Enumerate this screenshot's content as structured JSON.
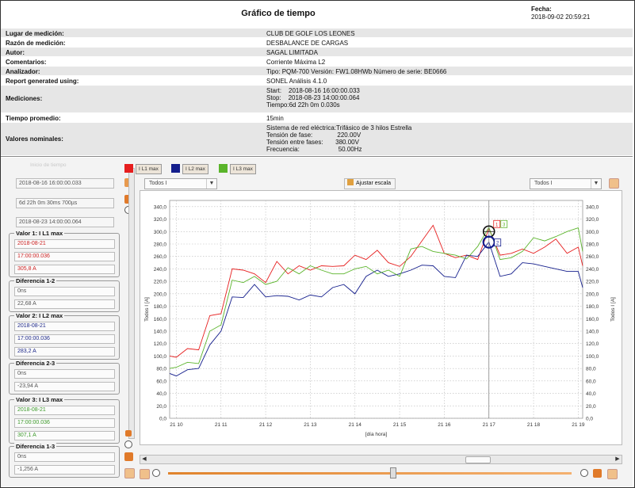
{
  "header": {
    "title": "Gráfico de tiempo",
    "fecha_label": "Fecha:",
    "fecha_value": "2018-09-02 20:59:21"
  },
  "report": [
    {
      "k": "Lugar de medición:",
      "v": [
        "CLUB DE GOLF LOS LEONES"
      ]
    },
    {
      "k": "Razón de medición:",
      "v": [
        "DESBALANCE DE CARGAS"
      ]
    },
    {
      "k": "Autor:",
      "v": [
        "SAGAL LIMITADA"
      ]
    },
    {
      "k": "Comentarios:",
      "v": [
        "Corriente Máxima L2"
      ]
    },
    {
      "k": "Analizador:",
      "v": [
        "Tipo: PQM-700 Versión: FW1.08HWb Número de serie: BE0666"
      ]
    },
    {
      "k": "Report generated using:",
      "v": [
        "SONEL Análisis 4.1.0"
      ]
    },
    {
      "k": "Mediciones:",
      "v": [
        "Start:    2018-08-16 16:00:00.033",
        "Stop:    2018-08-23 14:00:00.064",
        "Tiempo:6d 22h 0m 0.030s"
      ]
    },
    {
      "k": "Tiempo promedio:",
      "v": [
        "15min"
      ]
    },
    {
      "k": "Valores nominales:",
      "v": [
        "Sistema de red eléctrica:Trifásico de 3 hilos Estrella",
        "Tensión de fase:              220.00V",
        "Tensión entre fases:       380.00V",
        "Frecuencia:                      50.00Hz"
      ]
    }
  ],
  "left": {
    "faded_label": "Inicio de tiempo",
    "start": "2018-08-16 16:00:00.033",
    "span": "6d 22h 0m 30ms 700µs",
    "end": "2018-08-23 14:00:00.064",
    "panels": [
      {
        "title": "Valor 1: I L1 max",
        "fields": [
          "2018-08-21",
          "17:00:00.036",
          "305,8 A"
        ],
        "color": "#cc2222"
      },
      {
        "title": "Diferencia 1-2",
        "fields": [
          "0ns",
          "22,68 A"
        ],
        "color": "#555555"
      },
      {
        "title": "Valor 2: I L2 max",
        "fields": [
          "2018-08-21",
          "17:00:00.036",
          "283,2 A"
        ],
        "color": "#1f2a8a"
      },
      {
        "title": "Diferencia 2-3",
        "fields": [
          "0ns",
          "-23,94 A"
        ],
        "color": "#555555"
      },
      {
        "title": "Valor 3: I L3 max",
        "fields": [
          "2018-08-21",
          "17:00:00.036",
          "307,1 A"
        ],
        "color": "#3c9a2a"
      },
      {
        "title": "Diferencia 1-3",
        "fields": [
          "0ns",
          "-1,256 A"
        ],
        "color": "#555555"
      }
    ]
  },
  "legend": [
    {
      "name": "I L1 max",
      "color": "#e61e1e"
    },
    {
      "name": "I L2 max",
      "color": "#141e8c"
    },
    {
      "name": "I L3 max",
      "color": "#5ab42a"
    }
  ],
  "controls": {
    "left_select": "Todos I",
    "right_select": "Todos I",
    "ajustar": "Ajustar escala"
  },
  "icons": {
    "calendar": "calendar-icon",
    "zoom": "zoom-icon",
    "edit": "edit-icon"
  },
  "chart_data": {
    "type": "line",
    "xlabel": "[día hora]",
    "ylabel_left": "Todos I [A]",
    "ylabel_right": "Todos I [A]",
    "x_ticks": [
      "21 10",
      "21 11",
      "21 12",
      "21 13",
      "21 14",
      "21 15",
      "21 16",
      "21 17",
      "21 18",
      "21 19"
    ],
    "y_ticks": [
      "0,0",
      "20,0",
      "40,0",
      "60,0",
      "80,0",
      "100,0",
      "120,0",
      "140,0",
      "160,0",
      "180,0",
      "200,0",
      "220,0",
      "240,0",
      "260,0",
      "280,0",
      "300,0",
      "320,0",
      "340,0"
    ],
    "ylim": [
      0,
      350
    ],
    "xlim": [
      9.85,
      19.1
    ],
    "cursor_x": 17.0,
    "cursor_labels": [
      "1",
      "2",
      "3"
    ],
    "series": [
      {
        "name": "I L1 max",
        "color": "#e61e1e",
        "x": [
          9.85,
          10.0,
          10.25,
          10.5,
          10.75,
          11.0,
          11.25,
          11.5,
          11.75,
          12.0,
          12.25,
          12.5,
          12.75,
          13.0,
          13.25,
          13.5,
          13.75,
          14.0,
          14.25,
          14.5,
          14.75,
          15.0,
          15.25,
          15.5,
          15.75,
          16.0,
          16.25,
          16.5,
          16.75,
          17.0,
          17.25,
          17.5,
          17.75,
          18.0,
          18.25,
          18.5,
          18.75,
          19.0,
          19.1
        ],
        "y": [
          100,
          98,
          112,
          110,
          165,
          168,
          240,
          238,
          232,
          218,
          252,
          232,
          245,
          238,
          245,
          244,
          245,
          262,
          255,
          270,
          250,
          244,
          260,
          285,
          310,
          265,
          258,
          262,
          255,
          305,
          262,
          265,
          272,
          265,
          275,
          288,
          265,
          275,
          245
        ]
      },
      {
        "name": "I L2 max",
        "color": "#141e8c",
        "x": [
          9.85,
          10.0,
          10.25,
          10.5,
          10.75,
          11.0,
          11.25,
          11.5,
          11.75,
          12.0,
          12.25,
          12.5,
          12.75,
          13.0,
          13.25,
          13.5,
          13.75,
          14.0,
          14.25,
          14.5,
          14.75,
          15.0,
          15.25,
          15.5,
          15.75,
          16.0,
          16.25,
          16.5,
          16.75,
          17.0,
          17.25,
          17.5,
          17.75,
          18.0,
          18.25,
          18.5,
          18.75,
          19.0,
          19.1
        ],
        "y": [
          72,
          68,
          78,
          80,
          118,
          140,
          195,
          194,
          215,
          195,
          197,
          196,
          190,
          198,
          195,
          210,
          215,
          200,
          228,
          238,
          228,
          232,
          238,
          246,
          245,
          228,
          226,
          262,
          260,
          283,
          228,
          232,
          250,
          248,
          244,
          240,
          236,
          236,
          210
        ]
      },
      {
        "name": "I L3 max",
        "color": "#5ab42a",
        "x": [
          9.85,
          10.0,
          10.25,
          10.5,
          10.75,
          11.0,
          11.25,
          11.5,
          11.75,
          12.0,
          12.25,
          12.5,
          12.75,
          13.0,
          13.25,
          13.5,
          13.75,
          14.0,
          14.25,
          14.5,
          14.75,
          15.0,
          15.25,
          15.5,
          15.75,
          16.0,
          16.25,
          16.5,
          16.75,
          17.0,
          17.25,
          17.5,
          17.75,
          18.0,
          18.25,
          18.5,
          18.75,
          19.0,
          19.1
        ],
        "y": [
          80,
          82,
          90,
          88,
          140,
          150,
          222,
          218,
          228,
          215,
          220,
          242,
          232,
          245,
          238,
          232,
          232,
          240,
          244,
          232,
          238,
          228,
          272,
          276,
          268,
          265,
          262,
          256,
          276,
          307,
          255,
          258,
          268,
          290,
          285,
          292,
          300,
          306,
          268
        ]
      }
    ]
  }
}
